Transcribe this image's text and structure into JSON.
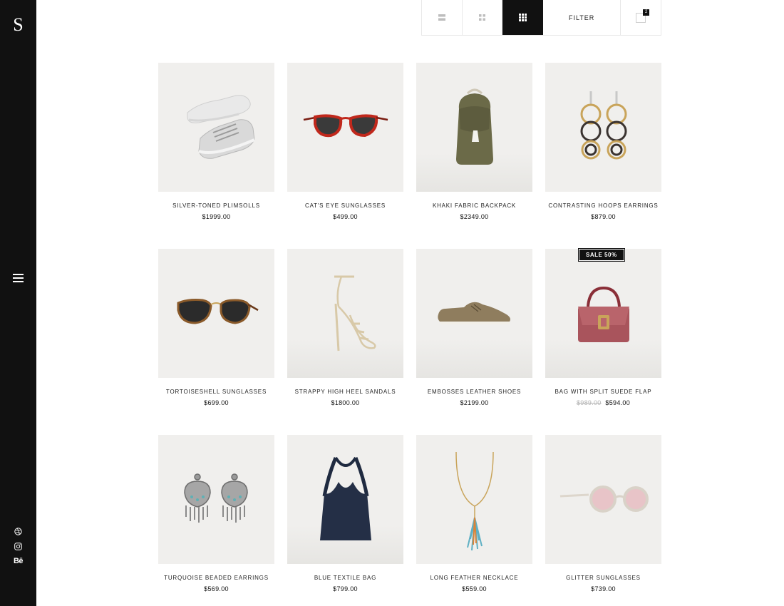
{
  "brand": {
    "logo": "S"
  },
  "toolbar": {
    "filter_label": "FILTER",
    "cart_count": "2",
    "active_view": "grid-4"
  },
  "products": [
    {
      "name": "SILVER-TONED PLIMSOLLS",
      "price": "$1999.00",
      "old_price": "",
      "badge": "",
      "icon": "sneakers-image"
    },
    {
      "name": "CAT'S EYE SUNGLASSES",
      "price": "$499.00",
      "old_price": "",
      "badge": "",
      "icon": "sunglasses-image"
    },
    {
      "name": "KHAKI FABRIC BACKPACK",
      "price": "$2349.00",
      "old_price": "",
      "badge": "",
      "icon": "backpack-image"
    },
    {
      "name": "CONTRASTING HOOPS EARRINGS",
      "price": "$879.00",
      "old_price": "",
      "badge": "",
      "icon": "earrings-image"
    },
    {
      "name": "TORTOISESHELL SUNGLASSES",
      "price": "$699.00",
      "old_price": "",
      "badge": "",
      "icon": "sunglasses-image"
    },
    {
      "name": "STRAPPY HIGH HEEL SANDALS",
      "price": "$1800.00",
      "old_price": "",
      "badge": "",
      "icon": "sandal-image"
    },
    {
      "name": "EMBOSSES LEATHER SHOES",
      "price": "$2199.00",
      "old_price": "",
      "badge": "",
      "icon": "shoe-image"
    },
    {
      "name": "BAG WITH SPLIT SUEDE FLAP",
      "price": "$594.00",
      "old_price": "$989.00",
      "badge": "SALE 50%",
      "icon": "handbag-image"
    },
    {
      "name": "TURQUOISE BEADED EARRINGS",
      "price": "$569.00",
      "old_price": "",
      "badge": "",
      "icon": "earrings-image"
    },
    {
      "name": "BLUE TEXTILE BAG",
      "price": "$799.00",
      "old_price": "",
      "badge": "",
      "icon": "tote-image"
    },
    {
      "name": "LONG FEATHER NECKLACE",
      "price": "$559.00",
      "old_price": "",
      "badge": "",
      "icon": "necklace-image"
    },
    {
      "name": "GLITTER SUNGLASSES",
      "price": "$739.00",
      "old_price": "",
      "badge": "",
      "icon": "sunglasses-image"
    }
  ],
  "social": {
    "dribbble": "dribbble-icon",
    "instagram": "instagram-icon",
    "behance_label": "Bē"
  },
  "colors": {
    "sidebar": "#111111",
    "tile": "#f0efed",
    "accent": "#111111"
  }
}
